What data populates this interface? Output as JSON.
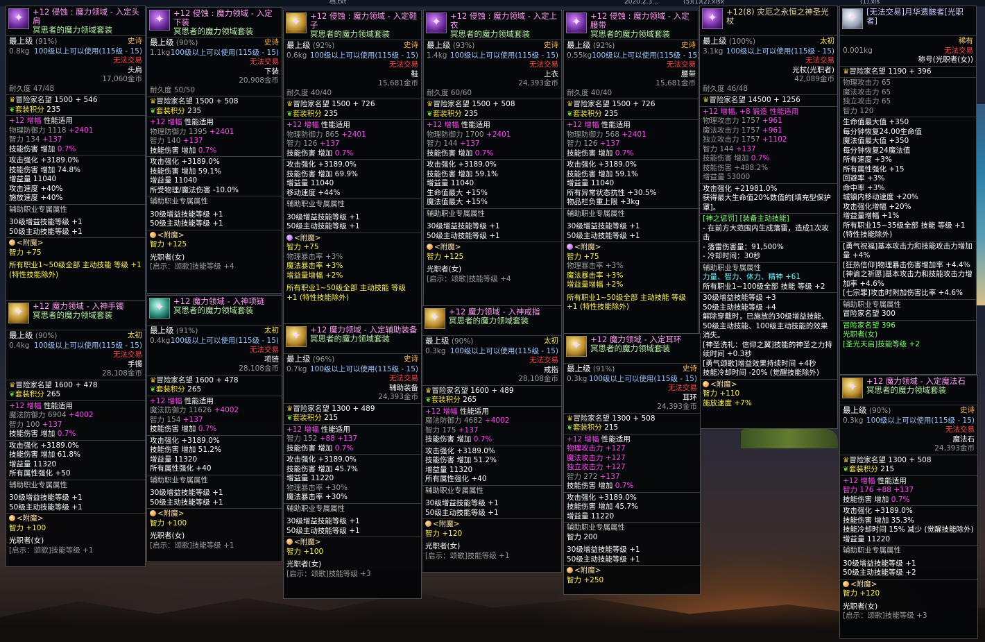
{
  "top_bar": {
    "file1": "档.txt",
    "file2": "2020.2.3...",
    "file3": "(5)(1)(2).xlsx",
    "file4": "(1).xls"
  },
  "common": {
    "tag_fame": "冒险家名望",
    "tag_set": "套装积分",
    "support_title": "辅助职业专属属性",
    "skill30": "30级增益技能等级 +1",
    "skill50": "50级主动技能等级 +1",
    "enchant": "<附魔>",
    "job": "光职者(女)",
    "hint": "[启示：颂歌]技能等级 +1",
    "hint3": "[启示：颂歌]技能等级 +3",
    "hint4": "[启示：颂歌]技能等级 +4",
    "top_grade": "最上级",
    "epic": "史诗",
    "taichu": "太初",
    "no_trade": "无法交易",
    "skill_dmg": "技能伤害 增加",
    "atk_strong": "攻击强化 +3189.0%",
    "amp": "+12 增幅",
    "perf": "性能适用",
    "all_1_50": "所有职业1~50级全部 主动技能 等级 +1 (特性技能除外)"
  },
  "c1": {
    "name": "+12 侵蚀 : 魔力领域 - 入定头肩",
    "set": "冥思者的魔力领域套装",
    "pct": "(91%)",
    "weight": "0.8kg",
    "level_req": "100级以上可以使用(115级 - 15)",
    "slot": "头肩",
    "price": "17,060金币",
    "durability": "耐久度 47/48",
    "fame": "1500 + 546",
    "set_pts": "235",
    "def_label": "物理防御力 1118",
    "def_bonus": "+2401",
    "int_label": "智力 134",
    "int_bonus": "+137",
    "dmg_val": "0.7%",
    "l1": "技能伤害 增加 74.8%",
    "l2": "增益量 11040",
    "l3": "攻击速度 +40%",
    "l4": "施放速度 +40%",
    "ench_val": "智力 +75"
  },
  "c2": {
    "name": "+12 侵蚀 : 魔力领域 - 入定下装",
    "set": "冥思者的魔力领域套装",
    "pct": "(90%)",
    "weight": "1.1kg",
    "level_req": "100级以上可以使用(115级 - 15)",
    "slot": "下装",
    "price": "20,908金币",
    "durability": "耐久度 50/50",
    "fame": "1500 + 508",
    "set_pts": "235",
    "def_label": "物理防御力 1395",
    "def_bonus": "+2401",
    "int_label": "智力 140",
    "int_bonus": "+137",
    "dmg_val": "0.7%",
    "l1": "技能伤害 增加 59.1%",
    "l2": "增益量 11040",
    "l3": "所受物理/魔法伤害 -10.0%",
    "ench_val": "智力 +125"
  },
  "c3": {
    "name": "+12 侵蚀 : 魔力领域 - 入定鞋子",
    "set": "冥思者的魔力领域套装",
    "pct": "(92%)",
    "weight": "0.6kg",
    "level_req": "100级以上可以使用(115级 - 15)",
    "slot": "鞋",
    "price": "15,681金币",
    "durability": "耐久度 40/40",
    "fame": "1500 + 726",
    "set_pts": "235",
    "def_label": "物理防御力 865",
    "def_bonus": "+2401",
    "int_label": "智力 126",
    "int_bonus": "+137",
    "dmg_val": "0.7%",
    "l1": "技能伤害 增加 69.9%",
    "l2": "增益量 11040",
    "l3": "移动速度 +44%",
    "ench_val": "智力 +75",
    "e2": "物理暴击率 +3%",
    "e3": "魔法暴击率 +3%",
    "e4": "增益量增幅 +2%"
  },
  "c4": {
    "name": "+12 侵蚀 : 魔力领域 - 入定上衣",
    "set": "冥思者的魔力领域套装",
    "pct": "(93%)",
    "weight": "1.4kg",
    "level_req": "100级以上可以使用(115级 - 15)",
    "slot": "上衣",
    "price": "24,393金币",
    "durability": "耐久度 60/60",
    "fame": "1500 + 508",
    "set_pts": "235",
    "def_label": "物理防御力 1700",
    "def_bonus": "+2401",
    "int_label": "智力 144",
    "int_bonus": "+137",
    "dmg_val": "0.7%",
    "l1": "技能伤害 增加 59.1%",
    "l2": "增益量 11040",
    "l3": "生命值最大 +15%",
    "l4": "魔法值最大 +15%",
    "ench_val": "智力 +125"
  },
  "c5": {
    "name": "+12 侵蚀 : 魔力领域 - 入定腰带",
    "set": "冥思者的魔力领域套装",
    "pct": "(92%)",
    "weight": "0.55kg",
    "level_req": "100级以上可以使用(115级 - 15)",
    "slot": "腰带",
    "price": "15,681金币",
    "durability": "耐久度 40/40",
    "fame": "1500 + 726",
    "set_pts": "235",
    "def_label": "物理防御力 568",
    "def_bonus": "+2401",
    "int_label": "智力 126",
    "int_bonus": "+137",
    "dmg_val": "0.7%",
    "l1": "技能伤害 增加 59.1%",
    "l2": "增益量 11040",
    "l3": "所有异常状态抗性 +30.5%",
    "l4": "物品栏负重上限 +3kg",
    "ench_val": "智力 +75",
    "e2": "物理暴击率 +3%",
    "e3": "魔法暴击率 +3%",
    "e4": "增益量增幅 +2%"
  },
  "c6": {
    "name": "+12(8) 灾厄之永恒之神圣光杖",
    "pct": "(100%)",
    "weight": "3.1kg",
    "level_req": "100级以上可以使用(115级 - 15)",
    "slot": "光杖(光职者)",
    "price": "42,089金币",
    "durability": "耐久度 46/48",
    "fame": "14500 + 1256",
    "amp_line": "+12 增幅, +8 锻造 性能适用",
    "a1": "物理攻击力 1757",
    "a1b": "+961",
    "a2": "魔法攻击力 1757",
    "a2b": "+961",
    "a3": "独立攻击力 1757",
    "a3b": "+1102",
    "int_label": "智力 144",
    "int_bonus": "+137",
    "dmg_val": "0.7%",
    "l1": "技能伤害 +488.2%",
    "l2": "增益量 53000",
    "l3": "攻击强化 +21981.0%",
    "l4": "获得最大生命值20%数值的[填充型保护罩]。",
    "skill_title": "[神之惩罚] [装备主动技能]",
    "s1": "- 在前方大范围内生成落雷，造成1次攻击",
    "s2": "- 落雷伤害量：91,500%",
    "s3": "- 冷却时间：30秒",
    "sup1": "力量、智力、体力、精神 +61",
    "sup2": "所有职业1~100级全部 技能 等级 +2",
    "k1": "30级增益技能等级 +3",
    "k2": "50级主动技能等级 +4",
    "k3": "解除穿戴时，已施放的30级增益技能、50级主动技能、100级主动技能的效果消失。",
    "k4": "[神圣洗礼：信仰之翼]技能的神圣之力持续时间 +0.3秒",
    "k5": "[勇气颂歌]增益效果持续时间 +4秒",
    "k6": "技能冷却时间 -20% (觉醒技能除外)",
    "ench_val": "智力 +110",
    "e2": "施放速度 +7%"
  },
  "c7": {
    "name": "[无法交易]月华遗骸者[光职者]",
    "grade_r": "稀有",
    "weight": "0.001kg",
    "title_lbl": "称号(光职者(女))",
    "fame": "1190 + 396",
    "a1": "物理攻击力 65",
    "a2": "魔法攻击力 65",
    "a3": "独立攻击力 65",
    "a4": "智力 120",
    "b1": "生命值最大值 +350",
    "b2": "每分钟恢复24.00生命值",
    "b3": "魔法值最大值 +350",
    "b4": "每分钟恢复24魔法值",
    "b5": "所有速度 +3%",
    "b6": "所有属性强化 +15",
    "b7": "回避率 +3%",
    "b8": "命中率 +3%",
    "b9": "城镇内移动速度 +20%",
    "b10": "攻击强化增幅 +20%",
    "b11": "增益量增幅 +1%",
    "b12": "所有职业15~35级全部 技能 等级 +1 (特性技能除外)",
    "d1": "[勇气祝福]基本攻击力和技能攻击力增加量 +4%",
    "d2": "[狂热信仰]物理暴击伤害增加率 +4.4%",
    "d3": "[神谕之祈愿]基本攻击力和技能攻击力增加率 +4.6%",
    "d4": "[七宗罪]攻击时附加伤害比率 +4.6%",
    "sup_fame": "冒险家名望 300",
    "f2": "冒险家名望 396",
    "f3": "光职者(女)",
    "f4": "[圣光天启]技能等级 +2"
  },
  "c8": {
    "name": "+12 魔力领域 - 入神手镯",
    "set": "冥思者的魔力领域套装",
    "pct": "(90%)",
    "weight": "0.4kg",
    "level_req": "100级以上可以使用(115级 - 15)",
    "slot": "手镯",
    "price": "28,108金币",
    "fame": "1600 + 478",
    "set_pts": "265",
    "def_label": "魔法防御力 6904",
    "def_bonus": "+4002",
    "int_label": "智力 100",
    "int_bonus": "+137",
    "dmg_val": "0.7%",
    "l1": "技能伤害 增加 61.8%",
    "l2": "增益量 11320",
    "l3": "所有属性强化 +50",
    "ench_val": "智力 +100"
  },
  "c9": {
    "name": "+12 魔力领域 - 入神项链",
    "set": "冥思者的魔力领域套装",
    "pct": "(91%)",
    "weight": "0.4kg",
    "level_req": "100级以上可以使用(115级 - 15)",
    "slot": "项链",
    "price": "28,108金币",
    "fame": "1600 + 478",
    "set_pts": "265",
    "def_label": "魔法防御力 11626",
    "def_bonus": "+4002",
    "int_label": "智力 154",
    "int_bonus": "+137",
    "dmg_val": "0.7%",
    "l1": "技能伤害 增加 51.2%",
    "l2": "增益量 11320",
    "l3": "所有属性强化 +40",
    "ench_val": "智力 +100"
  },
  "c10": {
    "name": "+12 魔力领域 - 入定辅助装备",
    "set": "冥思者的魔力领域套装",
    "pct": "(96%)",
    "weight": "0.7kg",
    "level_req": "100级以上可以使用(115级 - 15)",
    "slot": "辅助装备",
    "price": "24,393金币",
    "fame": "1300 + 489",
    "set_pts": "215",
    "int_label": "智力 152",
    "int_b1": "+88",
    "int_b2": "+137",
    "dmg_val": "0.7%",
    "l1": "技能伤害 增加 45.7%",
    "l2": "增益量 11220",
    "l3": "物理暴击率 +30%",
    "l4": "魔法暴击率 +30%",
    "ench_val": "智力 +100"
  },
  "c11": {
    "name": "+12 魔力领域 - 入神戒指",
    "set": "冥思者的魔力领域套装",
    "pct": "(90%)",
    "weight": "0.3kg",
    "level_req": "100级以上可以使用(115级 - 15)",
    "slot": "戒指",
    "price": "28,108金币",
    "fame": "1600 + 489",
    "set_pts": "265",
    "def_label": "魔法防御力 4682",
    "def_bonus": "+4002",
    "int_label": "智力 175",
    "int_bonus": "+137",
    "dmg_val": "0.7%",
    "l1": "技能伤害 增加 51.2%",
    "l2": "增益量 11320",
    "l3": "所有属性强化 +40",
    "ench_val": "智力 +120"
  },
  "c12": {
    "name": "+12 魔力领域 - 入定耳环",
    "set": "冥思者的魔力领域套装",
    "pct": "(91%)",
    "weight": "0.3kg",
    "level_req": "100级以上可以使用(115级 - 15)",
    "slot": "耳环",
    "price": "24,393金币",
    "fame": "1300 + 508",
    "set_pts": "215",
    "a1": "物理攻击力 +127",
    "a2": "魔法攻击力 +127",
    "a3": "独立攻击力 +127",
    "int_label": "智力 272",
    "int_bonus": "+137",
    "dmg_val": "0.7%",
    "l1": "技能伤害 增加 45.7%",
    "l2": "增益量 11220",
    "sup0": "智力 200",
    "ench_val": "智力 +250"
  },
  "c13": {
    "name": "+12 魔力领域 - 入定魔法石",
    "set": "冥思者的魔力领域套装",
    "pct": "(90%)",
    "weight": "0.3kg",
    "level_req": "100级以上可以使用(115级 - 15)",
    "slot": "魔法石",
    "price": "24,393金币",
    "fame": "1300 + 508",
    "set_pts": "215",
    "int_label": "智力 176",
    "int_b1": "+88",
    "int_b2": "+137",
    "dmg_val": "0.7%",
    "l1": "技能伤害 增加 35.3%",
    "l2": "技能冷却时间 15% 减少 (觉醒技能除外)",
    "l3": "增益量 11220",
    "sup2": "50级主动技能等级 +2",
    "ench_val": "智力 +120"
  }
}
